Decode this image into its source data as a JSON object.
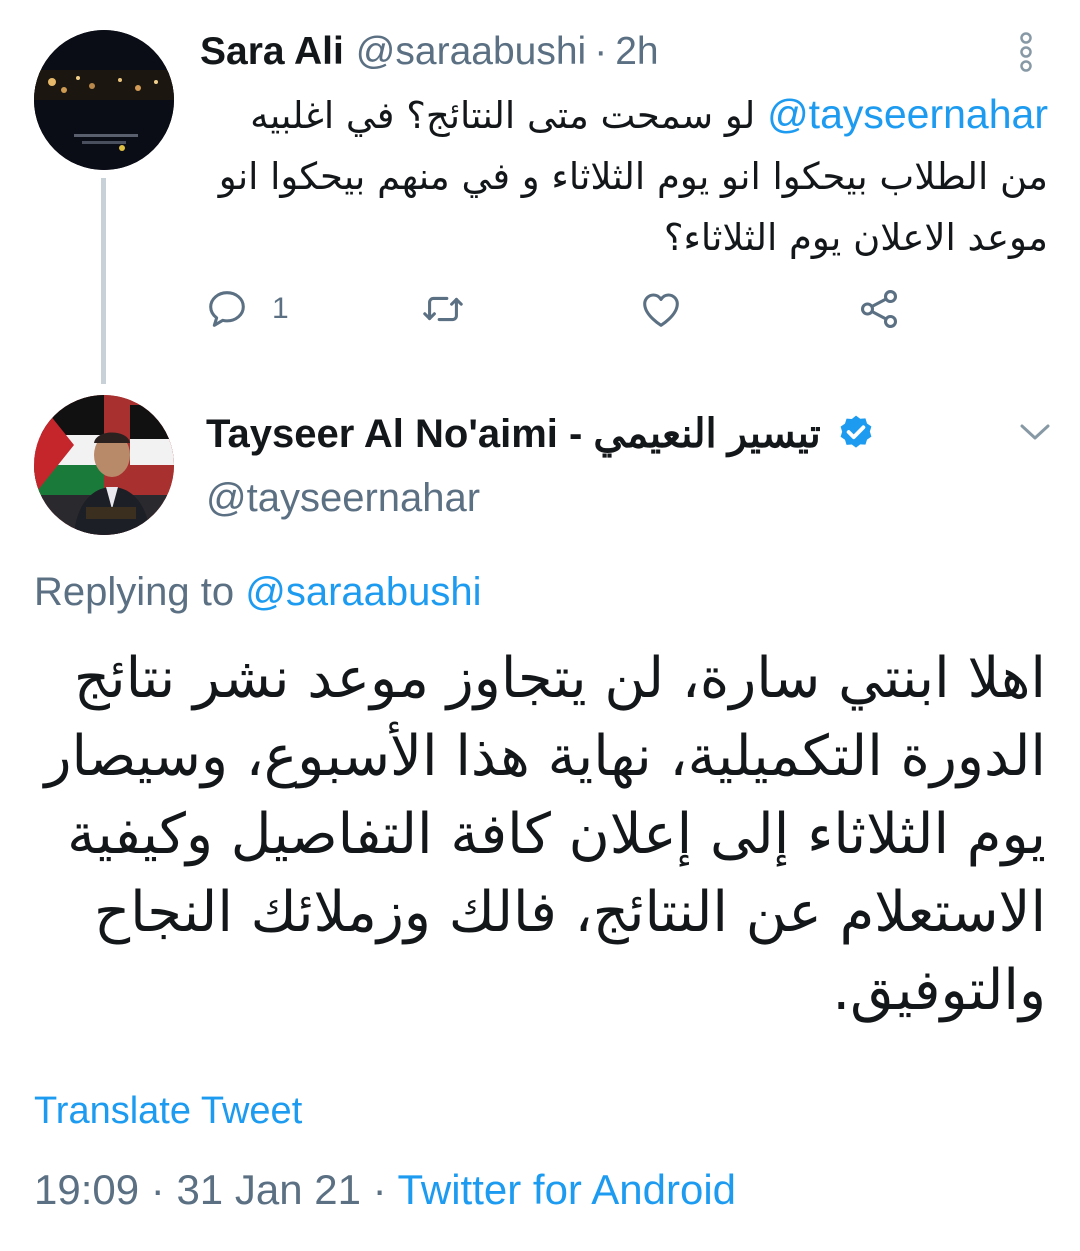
{
  "colors": {
    "link": "#1d9bf0",
    "secondary": "#5b7083",
    "text": "#14171a",
    "thread_line": "#c8d0d8"
  },
  "parent_tweet": {
    "author_name": "Sara Ali",
    "handle": "@saraabushi",
    "separator": "·",
    "time": "2h",
    "mention": "@tayseernahar",
    "text": " لو سمحت متى النتائج؟ في اغلبيه من الطلاب بيحكوا انو يوم الثلاثاء و في منهم بيحكوا انو موعد الاعلان يوم الثلاثاء؟",
    "icons": {
      "more": "more-vertical-icon",
      "reply": "reply-icon",
      "retweet": "retweet-icon",
      "like": "heart-icon",
      "share": "share-icon"
    },
    "reply_count": "1"
  },
  "reply_tweet": {
    "author_name": "Tayseer Al No'aimi - تيسير النعيمي",
    "verified_icon": "verified-badge-icon",
    "handle": "@tayseernahar",
    "replying_to_label": "Replying to",
    "replying_to_handle": "@saraabushi",
    "text": "اهلا ابنتي سارة، لن يتجاوز موعد نشر نتائج الدورة التكميلية، نهاية هذا الأسبوع، وسيصار يوم الثلاثاء إلى إعلان كافة التفاصيل وكيفية الاستعلام عن النتائج، فالك وزملائك النجاح والتوفيق.",
    "translate_label": "Translate Tweet",
    "time": "19:09",
    "separator": "·",
    "date": "31 Jan 21",
    "source": "Twitter for Android"
  }
}
